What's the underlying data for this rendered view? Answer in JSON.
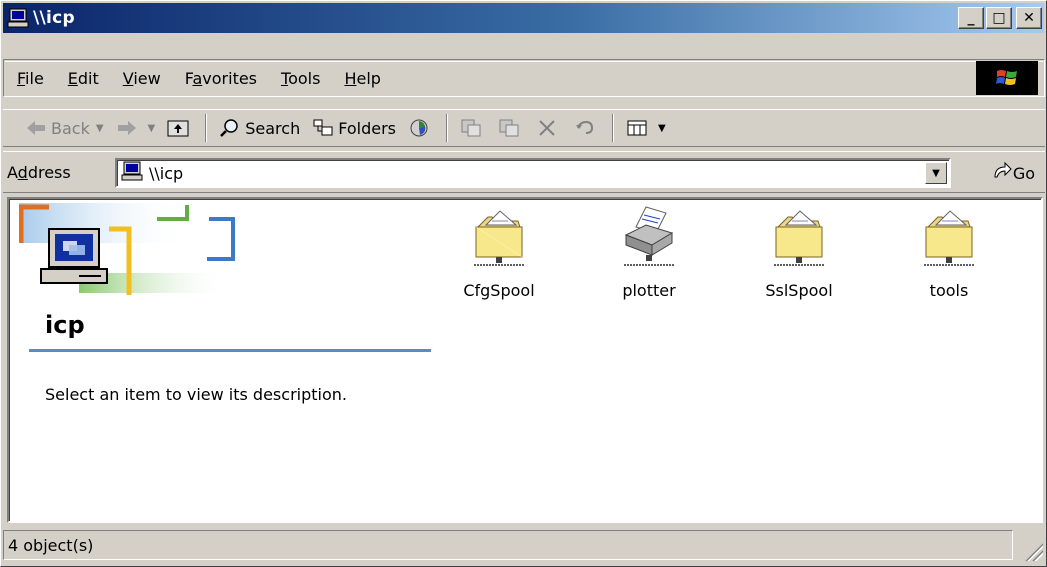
{
  "window": {
    "title": "\\\\icp",
    "minimize": "_",
    "maximize": "□",
    "close": "✕"
  },
  "menu": [
    {
      "label_pre": "",
      "accel": "F",
      "label_post": "ile"
    },
    {
      "label_pre": "",
      "accel": "E",
      "label_post": "dit"
    },
    {
      "label_pre": "",
      "accel": "V",
      "label_post": "iew"
    },
    {
      "label_pre": "F",
      "accel": "a",
      "label_post": "vorites"
    },
    {
      "label_pre": "",
      "accel": "T",
      "label_post": "ools"
    },
    {
      "label_pre": "",
      "accel": "H",
      "label_post": "elp"
    }
  ],
  "toolbar": {
    "back": "Back",
    "search": "Search",
    "folders": "Folders"
  },
  "address": {
    "label_pre": "A",
    "accel": "d",
    "label_post": "dress",
    "value": "\\\\icp",
    "go": "Go"
  },
  "content": {
    "folder_title": "icp",
    "description": "Select an item to view its description.",
    "items": [
      {
        "label": "CfgSpool",
        "icon": "shared-folder-icon"
      },
      {
        "label": "plotter",
        "icon": "shared-printer-icon"
      },
      {
        "label": "SslSpool",
        "icon": "shared-folder-icon"
      },
      {
        "label": "tools",
        "icon": "shared-folder-icon"
      }
    ]
  },
  "status": {
    "text": "4 object(s)"
  },
  "colors": {
    "title_start": "#0a246a",
    "title_end": "#a6caf0",
    "accent_line": "#5b8ac8",
    "chrome": "#d4d0c8"
  }
}
